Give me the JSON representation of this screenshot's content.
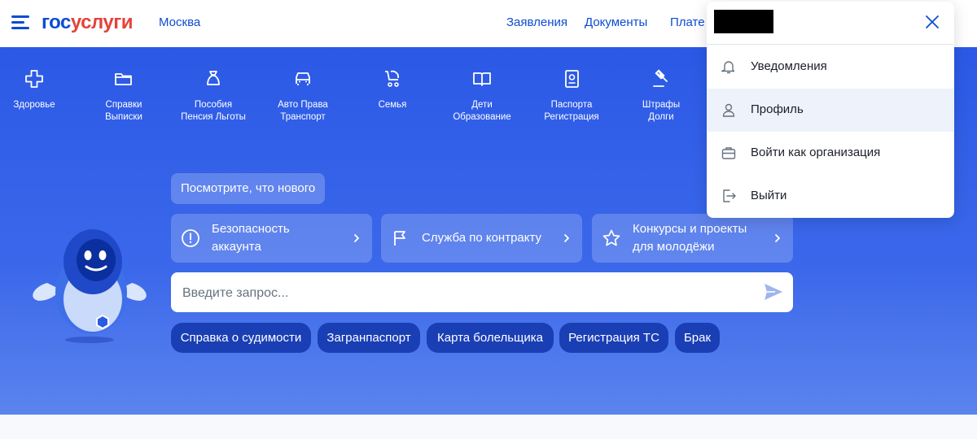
{
  "header": {
    "logo_part1": "гос",
    "logo_part2": "услуги",
    "city": "Москва",
    "nav": [
      "Заявления",
      "Документы",
      "Плате"
    ]
  },
  "categories": [
    {
      "line1": "Здоровье",
      "line2": "",
      "icon": "plus-cross-icon"
    },
    {
      "line1": "Справки",
      "line2": "Выписки",
      "icon": "folder-icon"
    },
    {
      "line1": "Пособия",
      "line2": "Пенсия Льготы",
      "icon": "money-bag-icon"
    },
    {
      "line1": "Авто Права",
      "line2": "Транспорт",
      "icon": "car-icon"
    },
    {
      "line1": "Семья",
      "line2": "",
      "icon": "stroller-icon"
    },
    {
      "line1": "Дети",
      "line2": "Образование",
      "icon": "book-icon"
    },
    {
      "line1": "Паспорта",
      "line2": "Регистрация",
      "icon": "passport-icon"
    },
    {
      "line1": "Штрафы",
      "line2": "Долги",
      "icon": "gavel-icon"
    }
  ],
  "whats_new": "Посмотрите, что нового",
  "cards": [
    {
      "line1": "Безопасность",
      "line2": "аккаунта",
      "icon": "exclamation-circle-icon"
    },
    {
      "line1": "Служба по контракту",
      "line2": "",
      "icon": "flag-icon"
    },
    {
      "line1": "Конкурсы и проекты",
      "line2": "для молодёжи",
      "icon": "star-icon"
    }
  ],
  "search": {
    "placeholder": "Введите запрос..."
  },
  "quick_links": [
    "Справка о судимости",
    "Загранпаспорт",
    "Карта болельщика",
    "Регистрация ТС",
    "Брак"
  ],
  "dropdown": {
    "items": [
      {
        "label": "Уведомления",
        "icon": "bell-icon"
      },
      {
        "label": "Профиль",
        "icon": "user-icon"
      },
      {
        "label": "Войти как организация",
        "icon": "briefcase-icon"
      },
      {
        "label": "Выйти",
        "icon": "logout-icon"
      }
    ]
  },
  "colors": {
    "brand_blue": "#0d4cd3",
    "brand_red": "#e4423c",
    "hero_blue": "#2b59e6",
    "pill_blue": "#1a3fb5"
  }
}
